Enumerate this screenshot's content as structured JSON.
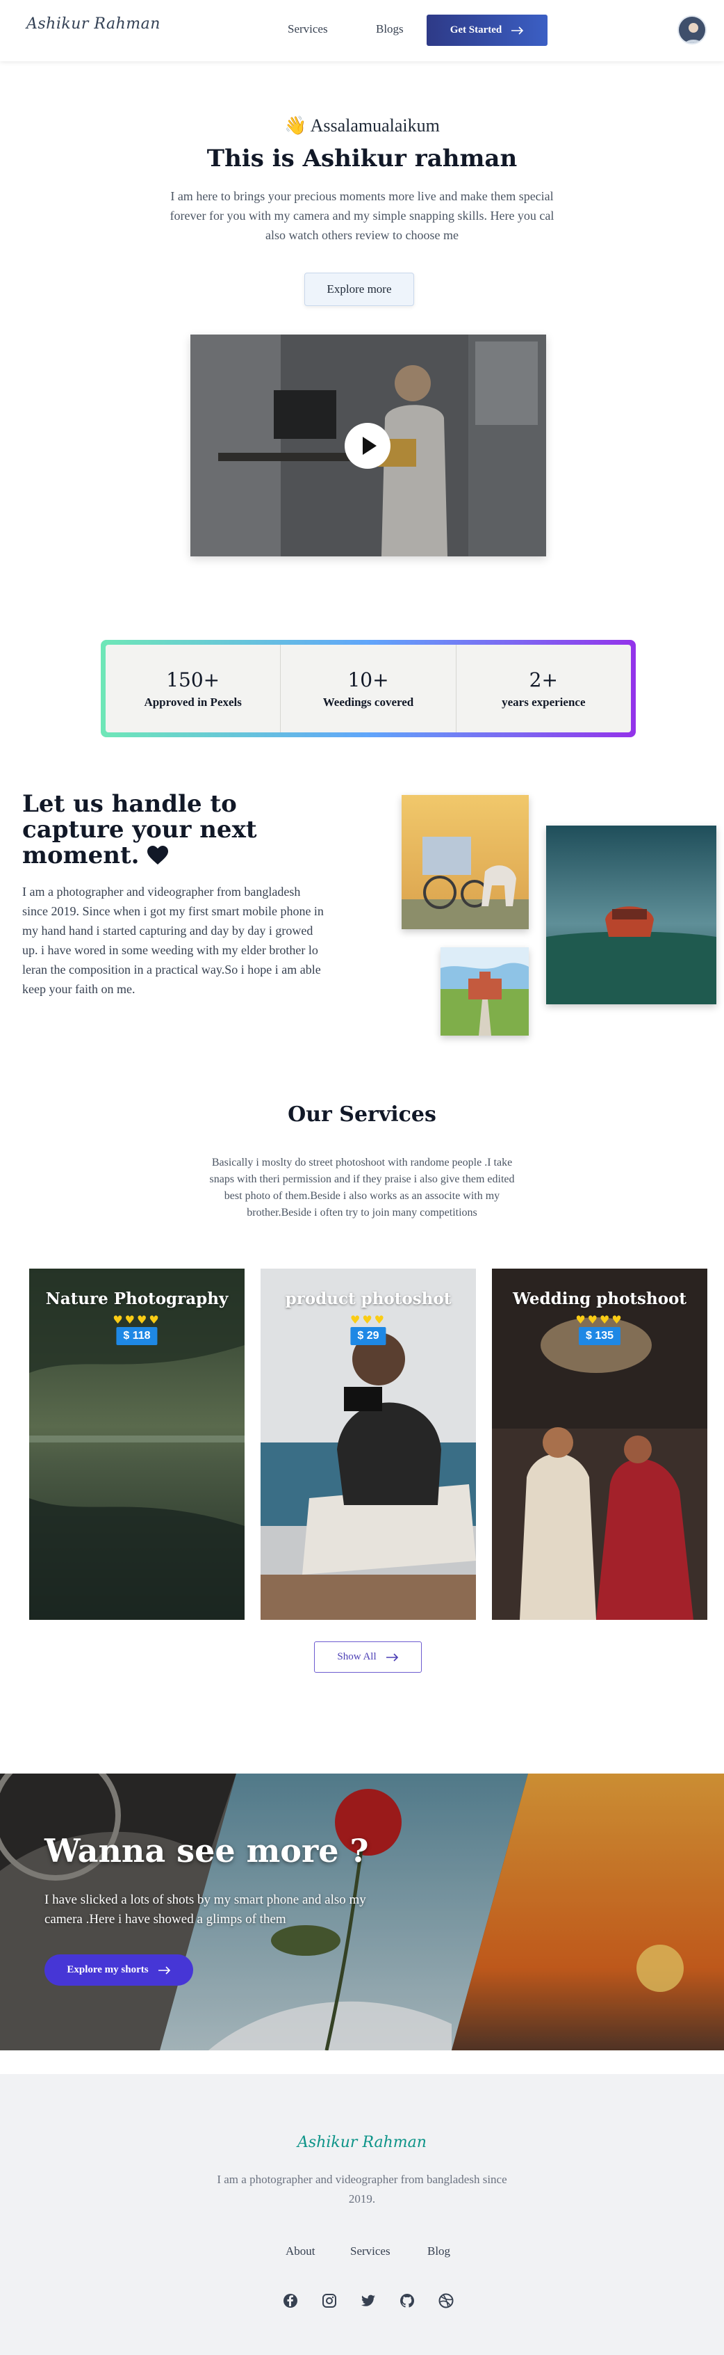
{
  "header": {
    "logo": "Ashikur Rahman",
    "nav": [
      {
        "label": "Services"
      },
      {
        "label": "Blogs"
      }
    ],
    "cta_label": "Get Started",
    "avatar_icon": "user-avatar"
  },
  "hero": {
    "greeting_emoji": "👋",
    "greeting": "Assalamualaikum",
    "title": "This is Ashikur rahman",
    "description": "I am here to brings your precious moments more live and make them special forever for you with my camera and my simple snapping skills. Here you cal also watch others review to choose me",
    "explore_label": "Explore more",
    "video_icon": "play-icon"
  },
  "stats": [
    {
      "value": "150+",
      "label": "Approved in Pexels"
    },
    {
      "value": "10+",
      "label": "Weedings covered"
    },
    {
      "value": "2+",
      "label": "years experience"
    }
  ],
  "about": {
    "title": "Let us handle to capture your next moment.",
    "title_icon": "black-heart",
    "description": "I am a photographer and videographer from bangladesh since 2019. Since when i got my first smart mobile phone in my hand hand i started capturing and day by day i growed up. i have wored in some weeding with my elder brother lo leran the composition in a practical way.So i hope i am able keep your faith on me."
  },
  "services": {
    "title": "Our Services",
    "description": "Basically i moslty do street photoshoot with randome people .I take snaps with theri permission and if they praise i also give them edited best photo of them.Beside i also works as an associte with my brother.Beside i often try to join many competitions",
    "cards": [
      {
        "title": "Nature Photography",
        "rating": "♥♥♥♥",
        "price": "$ 118"
      },
      {
        "title": "product photoshot",
        "rating": "♥♥♥",
        "price": "$ 29"
      },
      {
        "title": "Wedding photshoot",
        "rating": "♥♥♥♥",
        "price": "$ 135"
      }
    ],
    "show_all_label": "Show All"
  },
  "banner": {
    "title": "Wanna see more ?",
    "description": "I have slicked a lots of shots by my smart phone and also my camera .Here i have showed a glimps of them",
    "button_label": "Explore my shorts"
  },
  "footer": {
    "logo": "Ashikur Rahman",
    "description": "I am a photographer and videographer from bangladesh since 2019.",
    "links": [
      {
        "label": "About"
      },
      {
        "label": "Services"
      },
      {
        "label": "Blog"
      }
    ],
    "social_icons": [
      "facebook-icon",
      "instagram-icon",
      "twitter-icon",
      "github-icon",
      "dribbble-icon"
    ]
  },
  "colors": {
    "primary": "#2e3a87",
    "accent": "#4636d6",
    "teal": "#0d9488",
    "price_badge": "#1e88e5"
  }
}
